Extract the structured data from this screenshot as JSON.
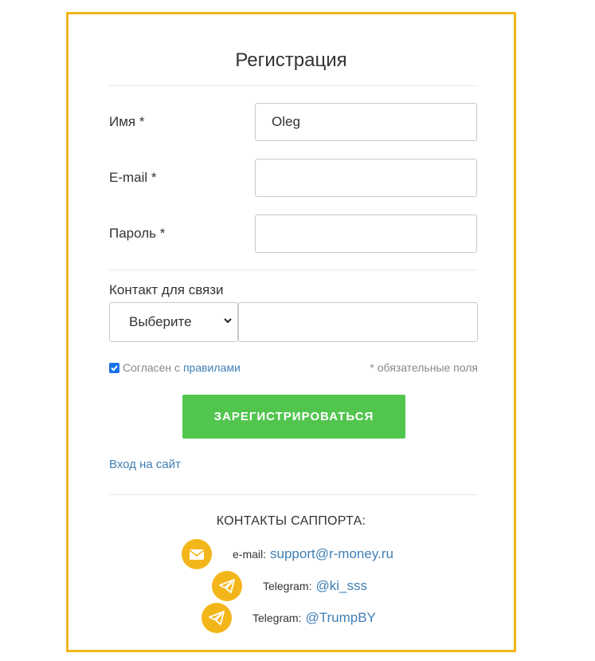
{
  "form": {
    "title": "Регистрация",
    "fields": [
      {
        "label": "Имя *",
        "value": "Oleg",
        "placeholder": ""
      },
      {
        "label": "E-mail *",
        "value": "",
        "placeholder": ""
      },
      {
        "label": "Пароль *",
        "value": "",
        "placeholder": ""
      }
    ],
    "contact_label": "Контакт для связи",
    "contact_select_value": "Выберите",
    "contact_value": "",
    "agree_checked": true,
    "agree_text": "Согласен с",
    "agree_link": "правилами",
    "required_note": "* обязательные поля",
    "submit_label": "ЗАРЕГИСТРИРОВАТЬСЯ",
    "login_link": "Вход на сайт"
  },
  "support": {
    "title": "КОНТАКТЫ САППОРТА:",
    "items": [
      {
        "icon": "envelope-icon",
        "label": "e-mail:",
        "value": "support@r-money.ru"
      },
      {
        "icon": "telegram-icon",
        "label": "Telegram:",
        "value": "@ki_sss"
      },
      {
        "icon": "telegram-icon",
        "label": "Telegram:",
        "value": "@TrumpBY"
      }
    ]
  },
  "colors": {
    "frame": "#f3b61a",
    "submit": "#52c54f",
    "link": "#3f7fb5",
    "icon_circle": "#f3b61a",
    "checkbox": "#1a73e8"
  }
}
